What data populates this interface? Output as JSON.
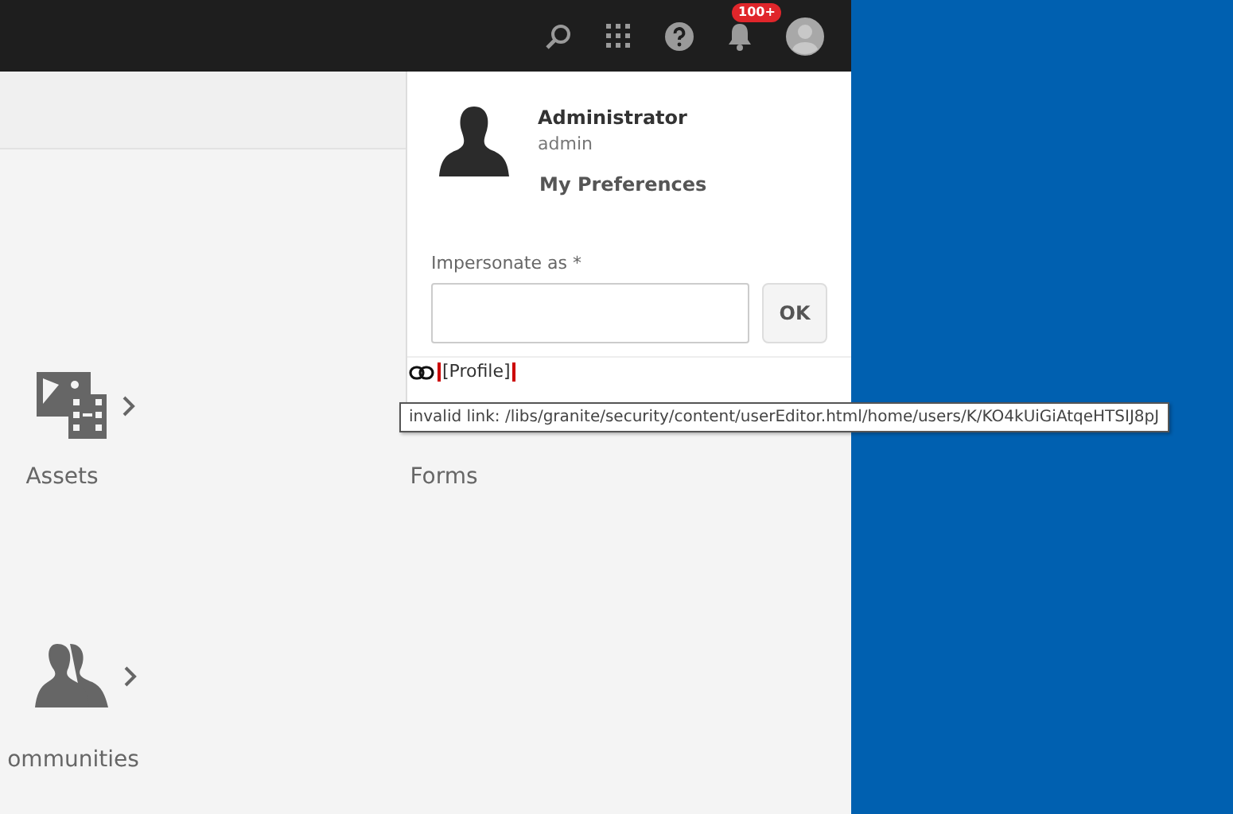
{
  "topbar": {
    "notification_badge": "100+"
  },
  "tiles": [
    {
      "kind": "assets",
      "label": "Assets"
    },
    {
      "kind": "forms",
      "label": "Forms"
    },
    {
      "kind": "communities",
      "label": "ommunities"
    }
  ],
  "user_panel": {
    "name": "Administrator",
    "username": "admin",
    "preferences_link": "My Preferences",
    "impersonate": {
      "label": "Impersonate as *"
    },
    "ok_button": "OK",
    "profile_link": "[Profile]"
  },
  "tooltip": "invalid link: /libs/granite/security/content/userEditor.html/home/users/K/KO4kUiGiAtqeHTSIJ8pJ"
}
